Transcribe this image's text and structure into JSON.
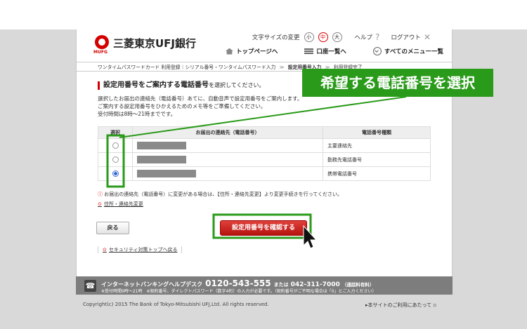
{
  "header": {
    "logo_sub": "MUFG",
    "logo_text": "三菱東京UFJ銀行",
    "font_size_label": "文字サイズの変更",
    "font_sizes": [
      "小",
      "中",
      "大"
    ],
    "help": "ヘルプ",
    "logout": "ログアウト",
    "nav": [
      "トップページへ",
      "口座一覧へ",
      "すべてのメニュー一覧"
    ]
  },
  "breadcrumb": [
    "ワンタイムパスワードカード 利用登録｜シリアル番号・ワンタイムパスワード入力",
    "設定用番号入力",
    "利用登録完了"
  ],
  "breadcrumb_sep": "≫",
  "main": {
    "title": "設定用番号をご案内する電話番号",
    "title_suffix": "を選択してください。",
    "desc": [
      "選択したお届出の連絡先（電話番号）あてに、自動音声で設定用番号をご案内します。",
      "ご案内する設定用番号をひかえるためのメモ等をご準備してください。",
      "受付時間は8時～21時までです。"
    ],
    "table": {
      "headers": [
        "選択",
        "お届出の連絡先（電話番号）",
        "電話番号種類"
      ],
      "rows": [
        {
          "type": "主要連絡先",
          "checked": false
        },
        {
          "type": "勤務先電話番号",
          "checked": false
        },
        {
          "type": "携帯電話番号",
          "checked": true
        }
      ]
    },
    "notice": "お届出の連絡先（電話番号）に変更がある場合は、【住所・連絡先変更】より変更手続きを行ってください。",
    "address_link": "住所・連絡先変更",
    "back_button": "戻る",
    "confirm_button": "設定用番号を確認する",
    "security_link": "セキュリティ対策トップへ戻る"
  },
  "footer": {
    "desk": "インターネットバンキングヘルプデスク",
    "number": "0120-543-555",
    "or": "または",
    "number2": "042-311-7000",
    "toll": "（通話料有料）",
    "note": "※受付時間9時～21時　※契約番号、ダイレクトパスワード（数字4桁）の入力が必要です。（契約番号がご不明な場合は「0」とご入力ください）",
    "copyright": "Copyright(c) 2015 The Bank of Tokyo-Mitsubishi UFJ,Ltd. All rights reserved.",
    "ext_link": "本サイトのご利用にあたって"
  },
  "annotation": {
    "label": "希望する電話番号を選択",
    "color": "#2a9a1a"
  },
  "icons": [
    "home-icon",
    "list-icon",
    "menu-icon",
    "help-icon",
    "close-icon",
    "phone-icon",
    "cursor-icon"
  ]
}
